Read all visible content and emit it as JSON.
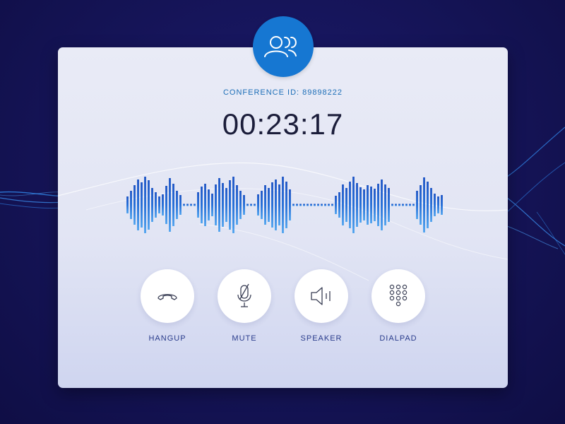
{
  "conference": {
    "id_label": "CONFERENCE ID:",
    "id_value": "89898222"
  },
  "call": {
    "timer": "00:23:17"
  },
  "controls": {
    "hangup": "HANGUP",
    "mute": "MUTE",
    "speaker": "SPEAKER",
    "dialpad": "DIALPAD"
  },
  "icons": {
    "avatar": "conference-users-icon",
    "hangup": "phone-handset-icon",
    "mute": "microphone-muted-icon",
    "speaker": "speaker-icon",
    "dialpad": "dialpad-icon"
  },
  "colors": {
    "accent": "#1677d2",
    "background": "#151457",
    "label": "#2a3c8c",
    "timer": "#1b1d3a"
  }
}
